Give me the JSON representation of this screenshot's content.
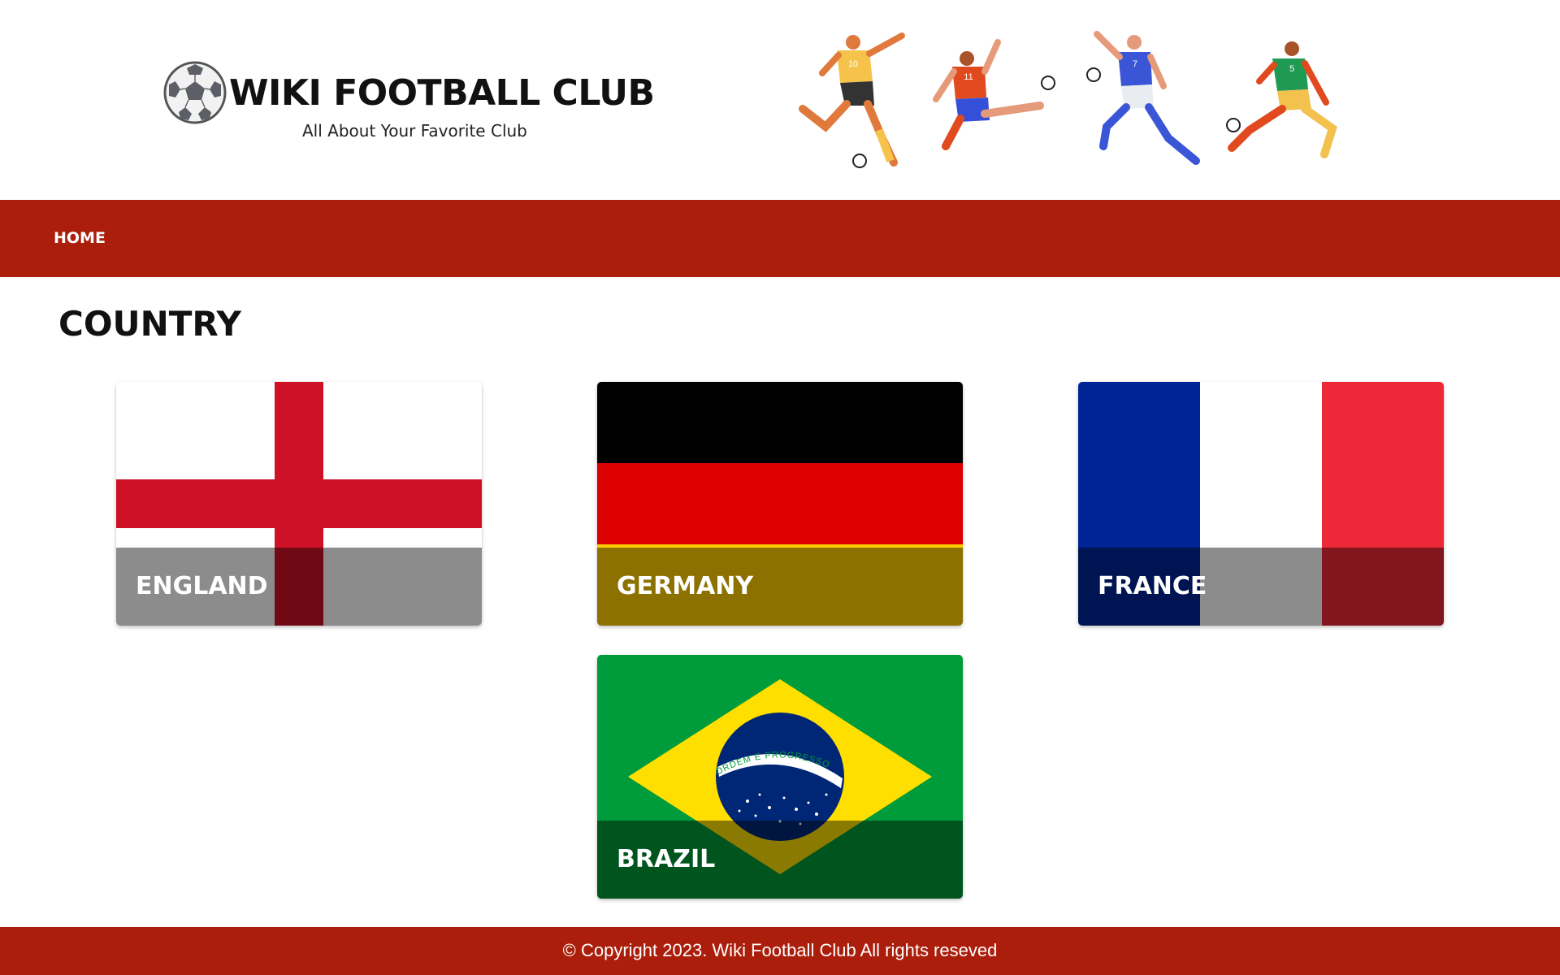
{
  "header": {
    "title": "WIKI FOOTBALL CLUB",
    "subtitle": "All About Your Favorite Club",
    "logo_icon": "soccer-ball-icon",
    "banner": "football-players-illustration",
    "player_numbers": [
      "10",
      "11",
      "7",
      "5"
    ]
  },
  "nav": {
    "items": [
      {
        "label": "HOME"
      }
    ],
    "background": "#ab1e0c"
  },
  "main": {
    "title": "COUNTRY",
    "countries": [
      {
        "label": "ENGLAND",
        "flag": "england-flag"
      },
      {
        "label": "GERMANY",
        "flag": "germany-flag"
      },
      {
        "label": "FRANCE",
        "flag": "france-flag"
      },
      {
        "label": "BRAZIL",
        "flag": "brazil-flag",
        "motto": "ORDEM E PROGRESSO"
      }
    ]
  },
  "footer": {
    "text": "© Copyright 2023. Wiki Football Club All rights reseved",
    "background": "#ab1e0c"
  }
}
